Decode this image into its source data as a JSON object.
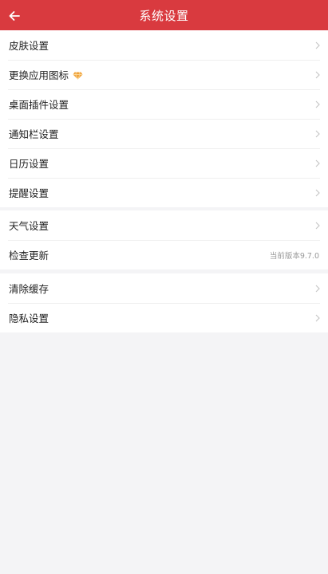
{
  "header": {
    "title": "系统设置",
    "back_icon": "arrow-left-icon"
  },
  "groups": [
    {
      "items": [
        {
          "label": "皮肤设置"
        },
        {
          "label": "更换应用图标",
          "badge_icon": "diamond-icon"
        },
        {
          "label": "桌面插件设置"
        },
        {
          "label": "通知栏设置"
        },
        {
          "label": "日历设置"
        },
        {
          "label": "提醒设置"
        }
      ]
    },
    {
      "items": [
        {
          "label": "天气设置"
        },
        {
          "label": "检查更新",
          "value": "当前版本9.7.0"
        }
      ]
    },
    {
      "items": [
        {
          "label": "清除缓存"
        },
        {
          "label": "隐私设置"
        }
      ]
    }
  ],
  "colors": {
    "brand": "#d93a3f",
    "background": "#f4f4f6",
    "badge": "#f0a23a"
  }
}
